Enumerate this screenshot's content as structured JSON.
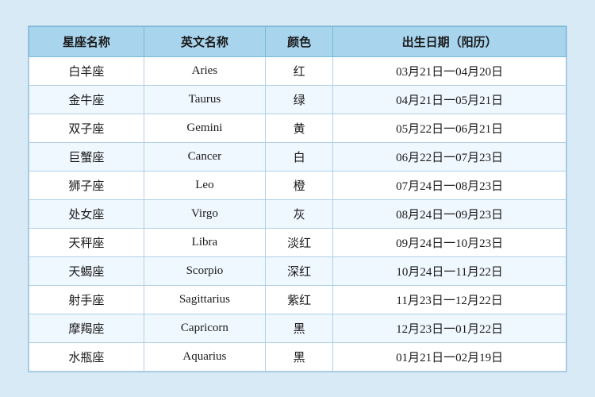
{
  "table": {
    "headers": [
      "星座名称",
      "英文名称",
      "颜色",
      "出生日期（阳历）"
    ],
    "rows": [
      {
        "zh": "白羊座",
        "en": "Aries",
        "color": "红",
        "dates": "03月21日一04月20日"
      },
      {
        "zh": "金牛座",
        "en": "Taurus",
        "color": "绿",
        "dates": "04月21日一05月21日"
      },
      {
        "zh": "双子座",
        "en": "Gemini",
        "color": "黄",
        "dates": "05月22日一06月21日"
      },
      {
        "zh": "巨蟹座",
        "en": "Cancer",
        "color": "白",
        "dates": "06月22日一07月23日"
      },
      {
        "zh": "狮子座",
        "en": "Leo",
        "color": "橙",
        "dates": "07月24日一08月23日"
      },
      {
        "zh": "处女座",
        "en": "Virgo",
        "color": "灰",
        "dates": "08月24日一09月23日"
      },
      {
        "zh": "天秤座",
        "en": "Libra",
        "color": "淡红",
        "dates": "09月24日一10月23日"
      },
      {
        "zh": "天蝎座",
        "en": "Scorpio",
        "color": "深红",
        "dates": "10月24日一11月22日"
      },
      {
        "zh": "射手座",
        "en": "Sagittarius",
        "color": "紫红",
        "dates": "11月23日一12月22日"
      },
      {
        "zh": "摩羯座",
        "en": "Capricorn",
        "color": "黑",
        "dates": "12月23日一01月22日"
      },
      {
        "zh": "水瓶座",
        "en": "Aquarius",
        "color": "黑",
        "dates": "01月21日一02月19日"
      }
    ]
  }
}
